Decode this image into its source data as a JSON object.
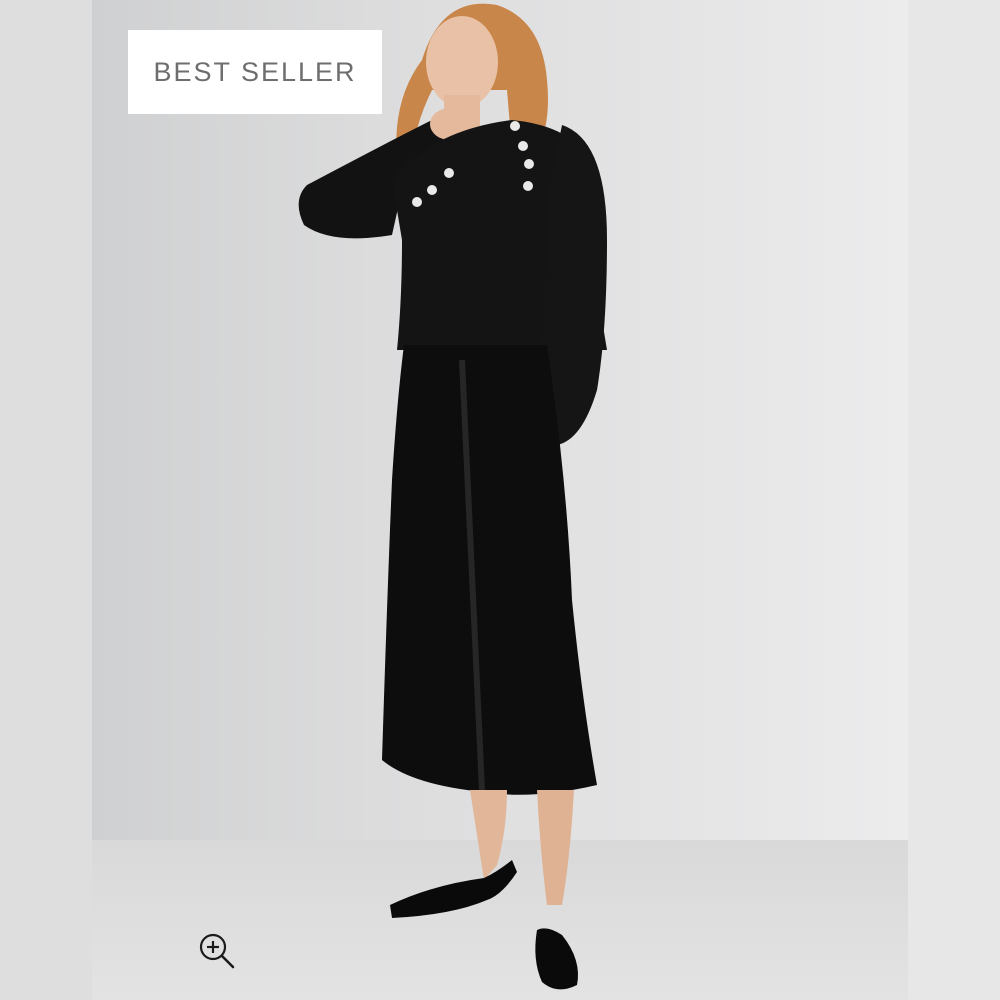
{
  "badge": {
    "label": "BEST SELLER"
  },
  "zoom": {
    "icon": "zoom-in-icon"
  },
  "colors": {
    "badge_bg": "#ffffff",
    "badge_text": "#6e6e6e",
    "garment": "#111111"
  }
}
